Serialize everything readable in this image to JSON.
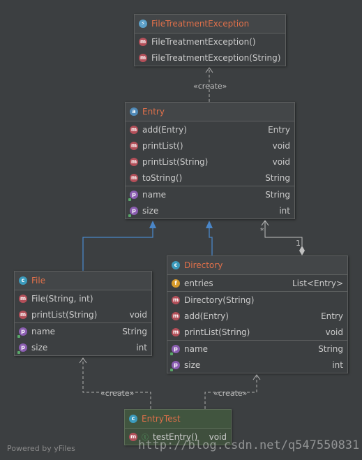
{
  "exception": {
    "title": "FileTreatmentException",
    "methods": [
      "FileTreatmentException()",
      "FileTreatmentException(String)"
    ]
  },
  "entry": {
    "title": "Entry",
    "methods": [
      {
        "name": "add(Entry)",
        "type": "Entry"
      },
      {
        "name": "printList()",
        "type": "void"
      },
      {
        "name": "printList(String)",
        "type": "void"
      },
      {
        "name": "toString()",
        "type": "String"
      }
    ],
    "fields": [
      {
        "name": "name",
        "type": "String"
      },
      {
        "name": "size",
        "type": "int"
      }
    ]
  },
  "file": {
    "title": "File",
    "methods": [
      {
        "name": "File(String, int)",
        "type": ""
      },
      {
        "name": "printList(String)",
        "type": "void"
      }
    ],
    "fields": [
      {
        "name": "name",
        "type": "String"
      },
      {
        "name": "size",
        "type": "int"
      }
    ]
  },
  "directory": {
    "title": "Directory",
    "entries": {
      "name": "entries",
      "type": "List<Entry>"
    },
    "methods": [
      {
        "name": "Directory(String)",
        "type": ""
      },
      {
        "name": "add(Entry)",
        "type": "Entry"
      },
      {
        "name": "printList(String)",
        "type": "void"
      }
    ],
    "fields": [
      {
        "name": "name",
        "type": "String"
      },
      {
        "name": "size",
        "type": "int"
      }
    ]
  },
  "entrytest": {
    "title": "EntryTest",
    "methods": [
      {
        "name": "testEntry()",
        "type": "void"
      }
    ]
  },
  "labels": {
    "create": "«create»",
    "creates_left": "«create»",
    "creates_right": "«create»",
    "mult_star": "*",
    "mult_one": "1"
  },
  "footer": "Powered by yFiles",
  "watermark": "http://blog.csdn.net/q547550831"
}
